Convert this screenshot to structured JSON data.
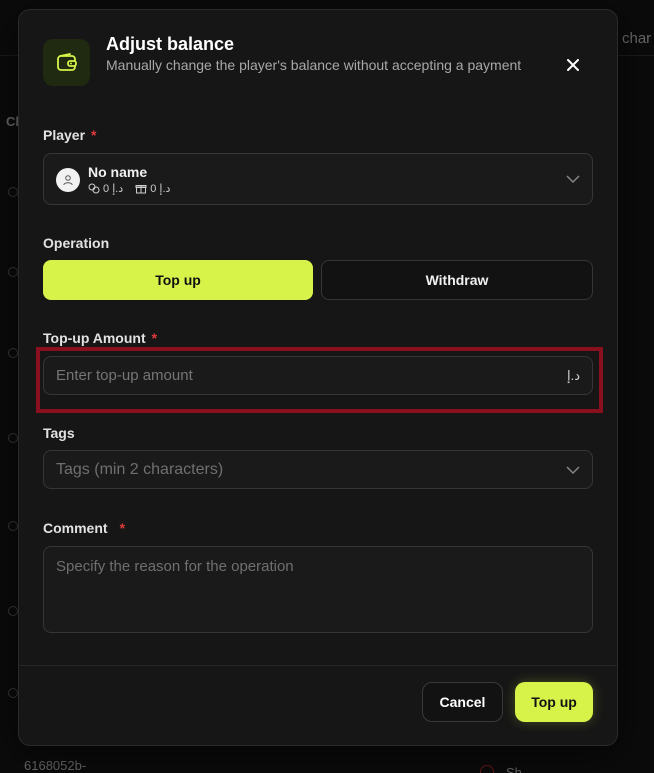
{
  "background": {
    "top_right_text": "char",
    "left_header_text": "Cl",
    "bottom_id_text": "6168052b-",
    "bottom_right_text": "Sh"
  },
  "modal": {
    "icon": "wallet-icon",
    "title": "Adjust balance",
    "subtitle": "Manually change the player's balance without accepting a payment",
    "close_icon": "close-icon"
  },
  "player": {
    "label": "Player",
    "required_mark": "*",
    "name": "No name",
    "balance_a": "0 د.إ",
    "balance_b": "0 د.إ",
    "avatar_icon": "user-icon"
  },
  "operation": {
    "label": "Operation",
    "options": [
      "Top up",
      "Withdraw"
    ],
    "selected": "Top up"
  },
  "amount": {
    "label": "Top-up Amount",
    "required_mark": "*",
    "placeholder": "Enter top-up amount",
    "value": "",
    "currency": "د.إ"
  },
  "tags": {
    "label": "Tags",
    "placeholder": "Tags (min 2 characters)"
  },
  "comment": {
    "label": "Comment",
    "required_mark": "*",
    "placeholder": "Specify the reason for the operation"
  },
  "footer": {
    "cancel_label": "Cancel",
    "submit_label": "Top up"
  },
  "colors": {
    "accent": "#d7f34a",
    "highlight_border": "#8a0f1f",
    "required": "#e23a3a"
  }
}
